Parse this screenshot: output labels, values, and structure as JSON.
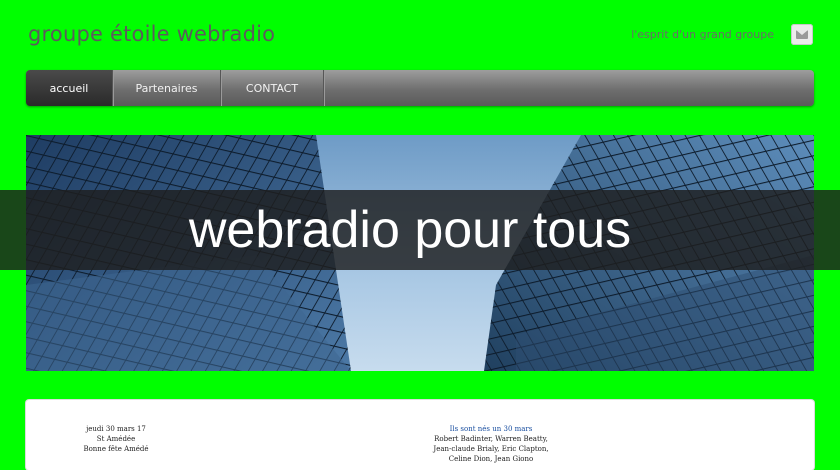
{
  "header": {
    "title": "groupe étoile webradio",
    "tagline": "l'esprit d'un grand groupe",
    "mail_icon": "envelope-icon"
  },
  "nav": {
    "items": [
      {
        "label": "accueil",
        "active": true
      },
      {
        "label": "Partenaires",
        "active": false
      },
      {
        "label": "CONTACT",
        "active": false
      }
    ]
  },
  "banner": {
    "headline": "webradio pour tous"
  },
  "ephemeride": {
    "date": "jeudi 30 mars 17",
    "saint": "St Amédée",
    "greeting": "Bonne fête Amédé"
  },
  "births": {
    "heading": "Ils sont nés un 30 mars",
    "line1": "Robert Badinter, Warren Beatty,",
    "line2": "Jean-claude Brialy, Eric Clapton,",
    "line3": "Celine Dion, Jean Giono"
  },
  "colors": {
    "background": "#00ff00",
    "nav_active": "#2f2f2f",
    "overlay": "#1e1e1e"
  }
}
